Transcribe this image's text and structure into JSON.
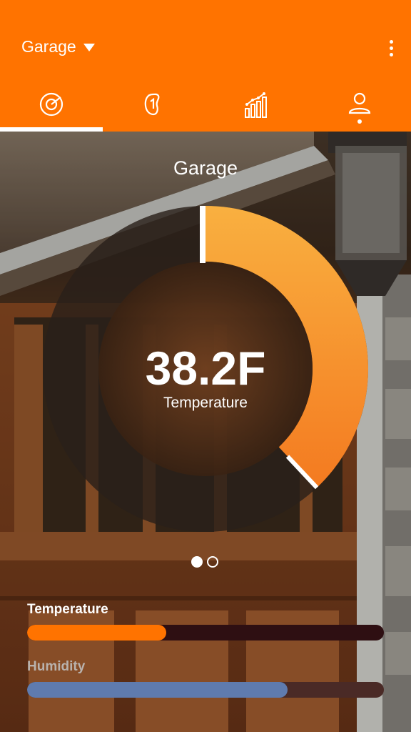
{
  "header": {
    "location": "Garage",
    "tabs": [
      {
        "id": "overview",
        "icon": "target-icon"
      },
      {
        "id": "sensor",
        "icon": "sensor-icon"
      },
      {
        "id": "stats",
        "icon": "bar-chart-icon"
      },
      {
        "id": "profile",
        "icon": "user-icon"
      }
    ],
    "active_tab": 0
  },
  "main": {
    "title": "Garage",
    "reading_value": "38.2F",
    "reading_label": "Temperature",
    "gauge_fraction": 0.38,
    "page_count": 2,
    "active_page": 0
  },
  "metrics": [
    {
      "label": "Temperature",
      "fraction": 0.39,
      "fill_color": "#FF7300",
      "track_color": "#2e0f12",
      "label_color": "#FFFFFF"
    },
    {
      "label": "Humidity",
      "fraction": 0.73,
      "fill_color": "#5f7bae",
      "track_color": "#4a2a26",
      "label_color": "#b9b2ad"
    }
  ],
  "colors": {
    "accent": "#FF7300",
    "gauge_start": "#F9B040",
    "gauge_end": "#F47A20"
  }
}
